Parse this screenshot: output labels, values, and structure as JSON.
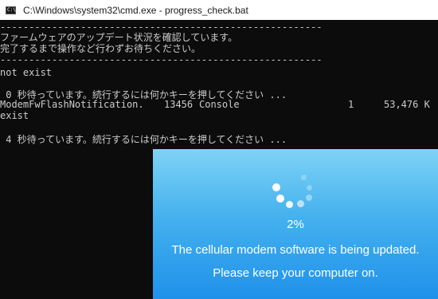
{
  "window": {
    "title": "C:\\Windows\\system32\\cmd.exe - progress_check.bat",
    "icon_text": "C:\\",
    "icon_name": "console-window-icon"
  },
  "console": {
    "text_color": "#cccccc",
    "background": "#0c0c0c",
    "separator": "--------------------------------------------------------",
    "line_confirming": "ファームウェアのアップデート状況を確認しています。",
    "line_wait": "完了するまで操作など行わずお待ちください。",
    "line_not_exist": "not exist",
    "line_timeout_0": " 0 秒待っています。続行するには何かキーを押してください ...",
    "process_row": {
      "image_name": "ModemFwFlashNotification.",
      "pid": "13456",
      "session_name": "Console",
      "session_num": "1",
      "mem_usage": "53,476 K"
    },
    "line_exist": "exist",
    "line_timeout_4": " 4 秒待っています。続行するには何かキーを押してください ..."
  },
  "update_notification": {
    "progress_text": "2%",
    "progress_fraction": 0.02,
    "message": "The cellular modem software is being updated.",
    "instruction": "Please keep your computer on.",
    "spinner_icon": "loading-spinner-icon",
    "colors": {
      "top": "#7fd3f6",
      "bottom": "#1f91ea",
      "text": "#ffffff"
    }
  }
}
